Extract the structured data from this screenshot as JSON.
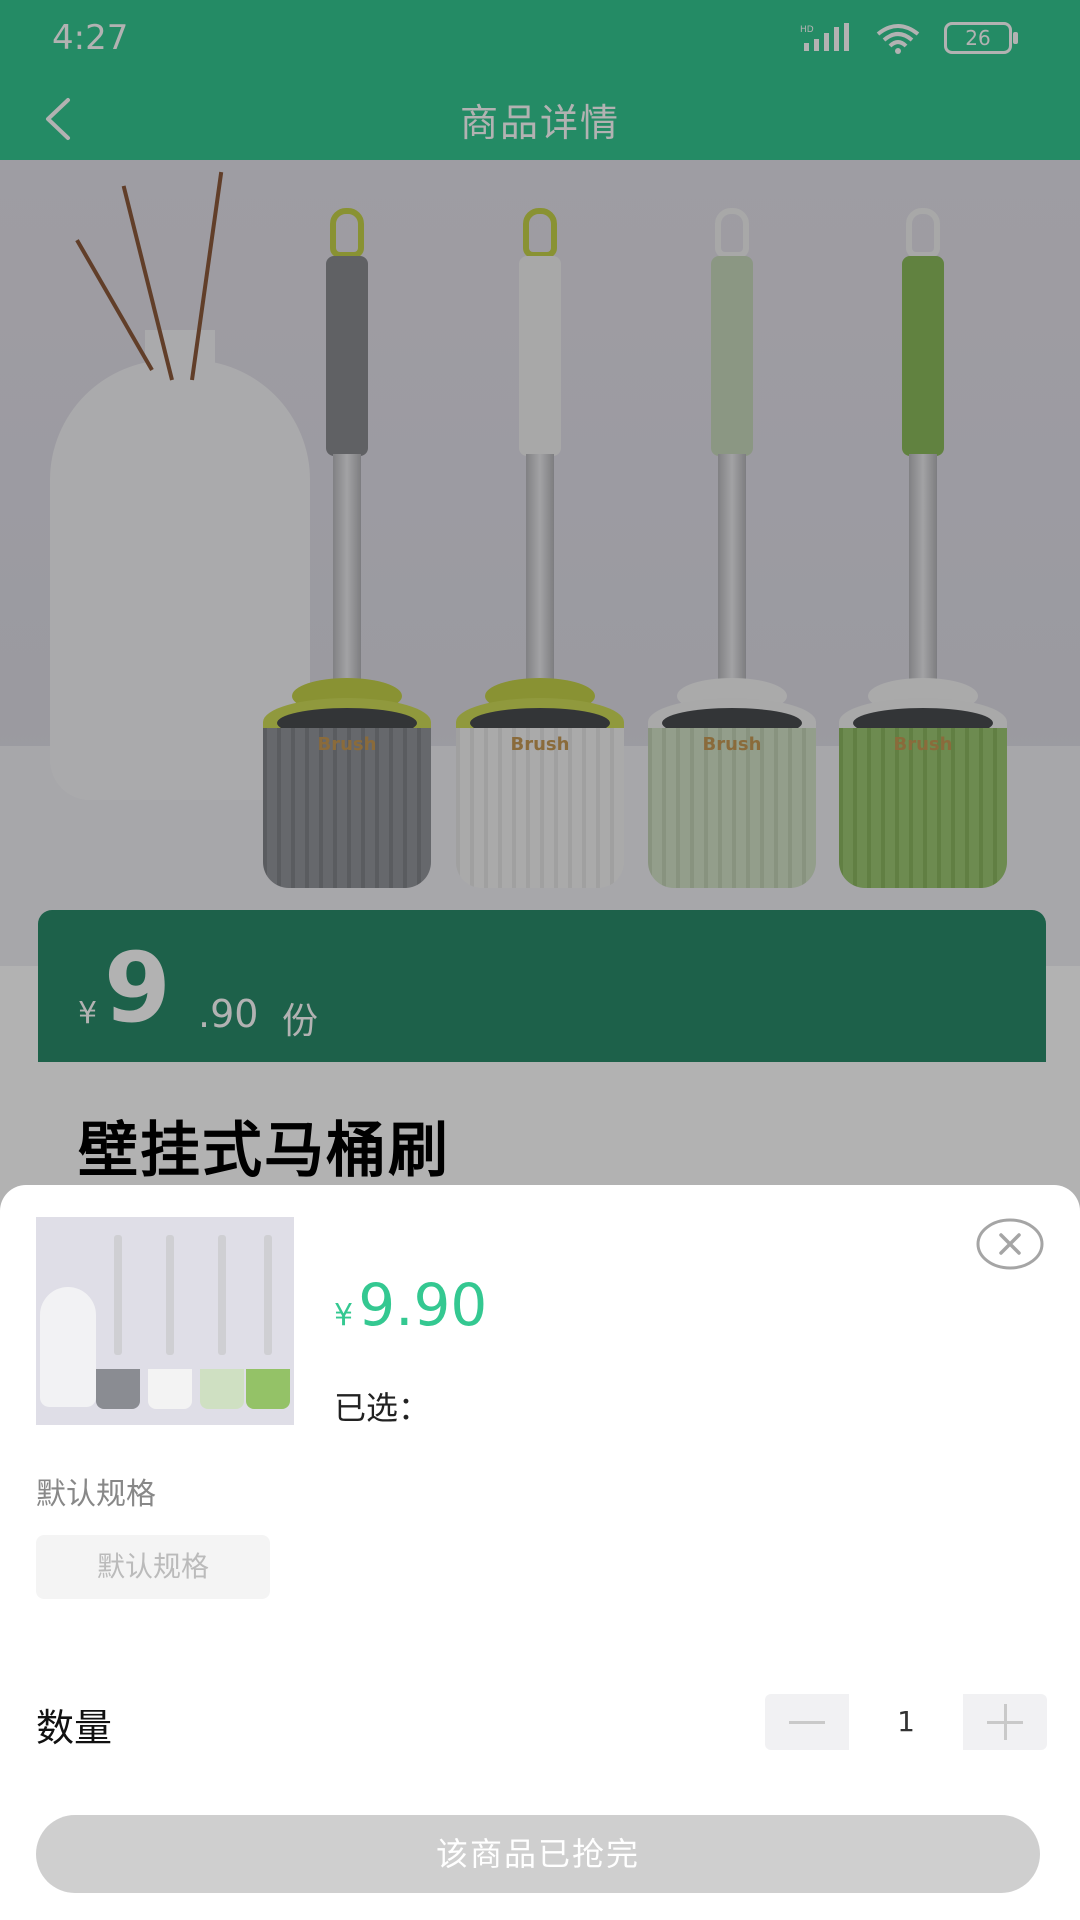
{
  "status_bar": {
    "time": "4:27",
    "battery": "26"
  },
  "nav": {
    "title": "商品详情"
  },
  "product": {
    "price_currency": "¥",
    "price_integer": "9",
    "price_decimal": ".90",
    "price_unit": "份",
    "title": "壁挂式马桶刷",
    "brand_text": "Brush"
  },
  "sheet": {
    "price_currency": "¥",
    "price": "9.90",
    "selected_label": "已选：",
    "spec_heading": "默认规格",
    "spec_options": [
      "默认规格"
    ],
    "quantity_label": "数量",
    "quantity": "1",
    "buy_button": "该商品已抢完"
  },
  "colors": {
    "accent": "#34c891",
    "price_band": "#2a8c6a",
    "disabled_button": "#cfcfcf"
  }
}
